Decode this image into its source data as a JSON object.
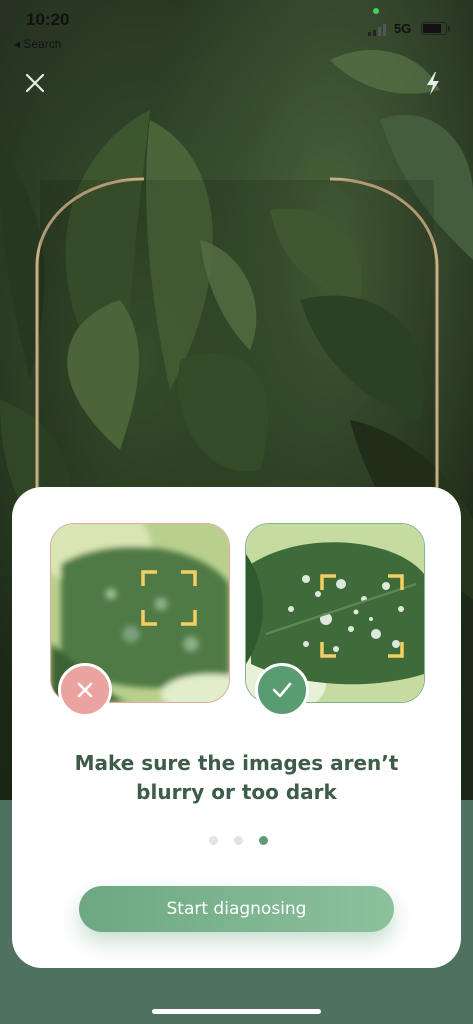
{
  "status_bar": {
    "time": "10:20",
    "back_app": "◂ Search",
    "network": "5G"
  },
  "camera": {
    "close_icon": "close-icon",
    "flash_icon": "flash-icon"
  },
  "tips_card": {
    "bad_example_icon": "x-icon",
    "good_example_icon": "check-icon",
    "headline_line1": "Make sure the images aren’t",
    "headline_line2": "blurry or too dark",
    "pager": {
      "total": 3,
      "active_index": 2
    },
    "button_label": "Start diagnosing"
  },
  "colors": {
    "accent": "#5f9a76",
    "bad": "#eaa39e",
    "good": "#5a9c71",
    "frame": "#c9ae84",
    "focus": "#f5cf63"
  }
}
